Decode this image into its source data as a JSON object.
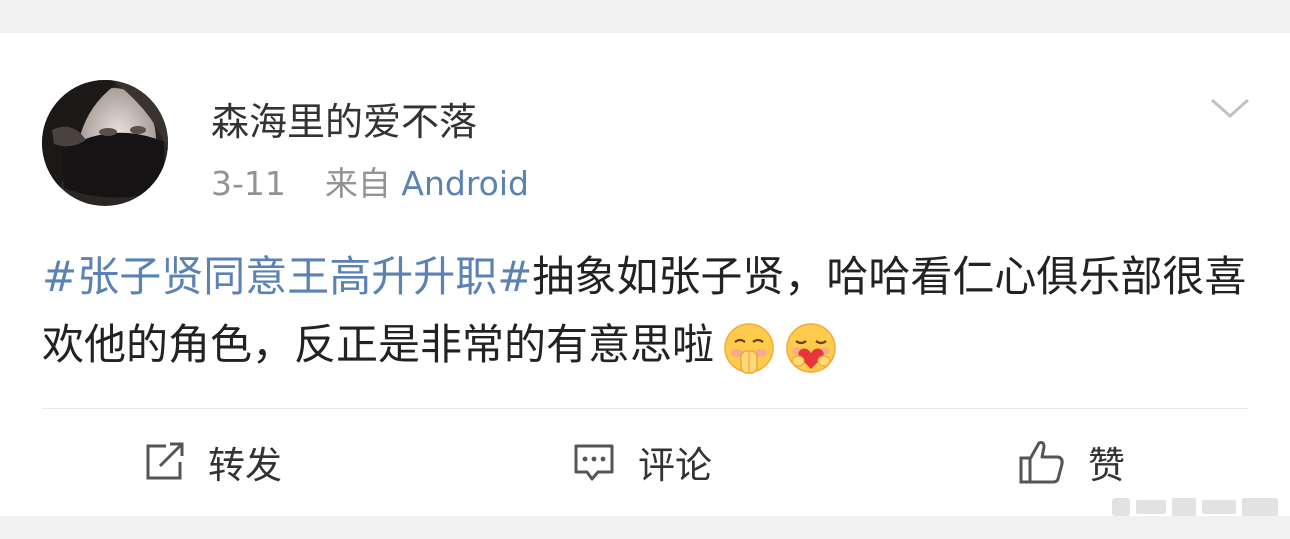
{
  "post": {
    "author": "森海里的爱不落",
    "date": "3-11",
    "source_prefix": "来自",
    "source": "Android",
    "topic": "#张子贤同意王高升升职#",
    "body": "抽象如张子贤，哈哈看仁心俱乐部很喜欢他的角色，反正是非常的有意思啦"
  },
  "icons": {
    "menu": "chevron-down-icon",
    "emoji1": "pleading-face-emoji",
    "emoji2": "heart-hug-face-emoji",
    "repost": "repost-icon",
    "comment": "comment-icon",
    "like": "thumbs-up-icon"
  },
  "actions": {
    "repost": "转发",
    "comment": "评论",
    "like": "赞"
  },
  "colors": {
    "link": "#5b82b4",
    "text": "#222222",
    "meta": "#939393",
    "background_strip": "#f1f1f1"
  }
}
